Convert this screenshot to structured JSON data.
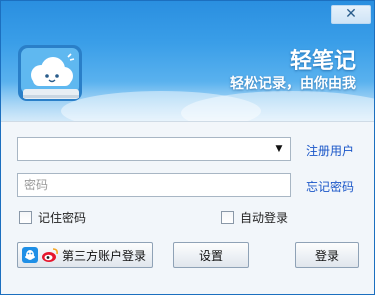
{
  "window": {
    "close_glyph": "✕"
  },
  "header": {
    "app_name": "轻笔记",
    "slogan": "轻松记录，由你由我"
  },
  "login": {
    "username_value": "",
    "password_placeholder": "密码",
    "register_link": "注册用户",
    "forgot_link": "忘记密码",
    "remember_label": "记住密码",
    "auto_login_label": "自动登录",
    "third_party_label": "第三方账户登录",
    "settings_label": "设置",
    "login_label": "登录"
  },
  "colors": {
    "header_blue": "#2a8fe0",
    "link_blue": "#1a56c8"
  }
}
